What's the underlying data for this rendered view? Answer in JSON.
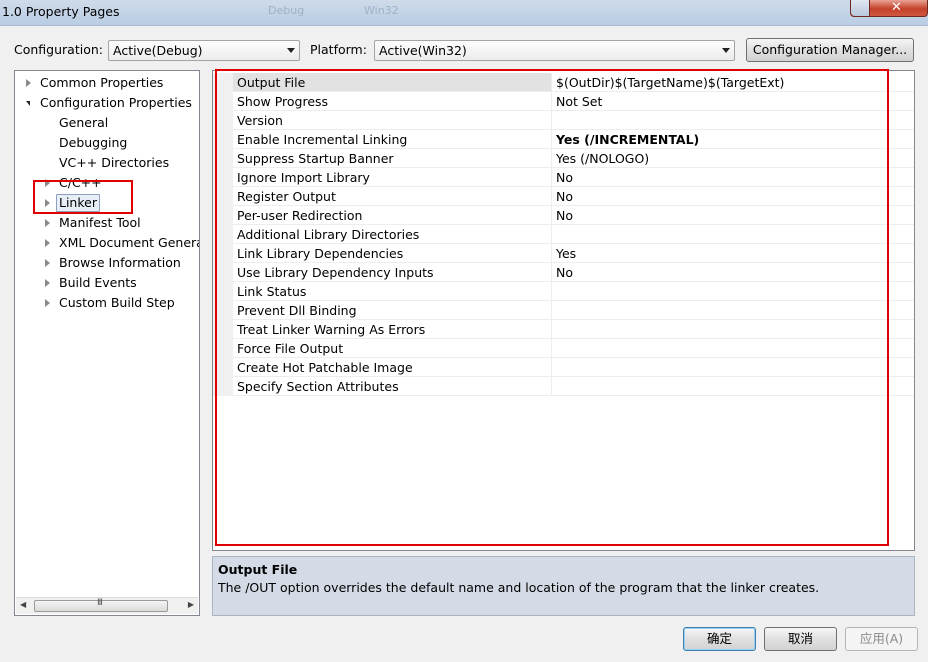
{
  "window": {
    "title": "1.0 Property Pages",
    "ghost_tabs": [
      "Debug",
      "Win32"
    ],
    "close_label": "✕"
  },
  "toolbar": {
    "configuration_label": "Configuration:",
    "configuration_value": "Active(Debug)",
    "platform_label": "Platform:",
    "platform_value": "Active(Win32)",
    "config_manager_label": "Configuration Manager..."
  },
  "tree": {
    "items": [
      {
        "label": "Common Properties",
        "toggle": "collapsed"
      },
      {
        "label": "Configuration Properties",
        "toggle": "expanded"
      },
      {
        "label": "General",
        "toggle": "none"
      },
      {
        "label": "Debugging",
        "toggle": "none"
      },
      {
        "label": "VC++ Directories",
        "toggle": "none"
      },
      {
        "label": "C/C++",
        "toggle": "collapsed"
      },
      {
        "label": "Linker",
        "toggle": "collapsed",
        "selected": true
      },
      {
        "label": "Manifest Tool",
        "toggle": "collapsed"
      },
      {
        "label": "XML Document Generat",
        "toggle": "collapsed"
      },
      {
        "label": "Browse Information",
        "toggle": "collapsed"
      },
      {
        "label": "Build Events",
        "toggle": "collapsed"
      },
      {
        "label": "Custom Build Step",
        "toggle": "collapsed"
      }
    ],
    "scroll_grip": "III"
  },
  "grid": {
    "rows": [
      {
        "name": "Output File",
        "value": "$(OutDir)$(TargetName)$(TargetExt)",
        "bold": false,
        "selected": true
      },
      {
        "name": "Show Progress",
        "value": "Not Set",
        "bold": false
      },
      {
        "name": "Version",
        "value": "",
        "bold": false
      },
      {
        "name": "Enable Incremental Linking",
        "value": "Yes (/INCREMENTAL)",
        "bold": true
      },
      {
        "name": "Suppress Startup Banner",
        "value": "Yes (/NOLOGO)",
        "bold": false
      },
      {
        "name": "Ignore Import Library",
        "value": "No",
        "bold": false
      },
      {
        "name": "Register Output",
        "value": "No",
        "bold": false
      },
      {
        "name": "Per-user Redirection",
        "value": "No",
        "bold": false
      },
      {
        "name": "Additional Library Directories",
        "value": "",
        "bold": false
      },
      {
        "name": "Link Library Dependencies",
        "value": "Yes",
        "bold": false
      },
      {
        "name": "Use Library Dependency Inputs",
        "value": "No",
        "bold": false
      },
      {
        "name": "Link Status",
        "value": "",
        "bold": false
      },
      {
        "name": "Prevent Dll Binding",
        "value": "",
        "bold": false
      },
      {
        "name": "Treat Linker Warning As Errors",
        "value": "",
        "bold": false
      },
      {
        "name": "Force File Output",
        "value": "",
        "bold": false
      },
      {
        "name": "Create Hot Patchable Image",
        "value": "",
        "bold": false
      },
      {
        "name": "Specify Section Attributes",
        "value": "",
        "bold": false
      }
    ]
  },
  "description": {
    "title": "Output File",
    "text": "The /OUT option overrides the default name and location of the program that the linker creates."
  },
  "buttons": {
    "ok": "确定",
    "cancel": "取消",
    "apply": "应用(A)"
  },
  "colors": {
    "annotation_red": "#e00000",
    "description_bg": "#d4dbe6"
  }
}
